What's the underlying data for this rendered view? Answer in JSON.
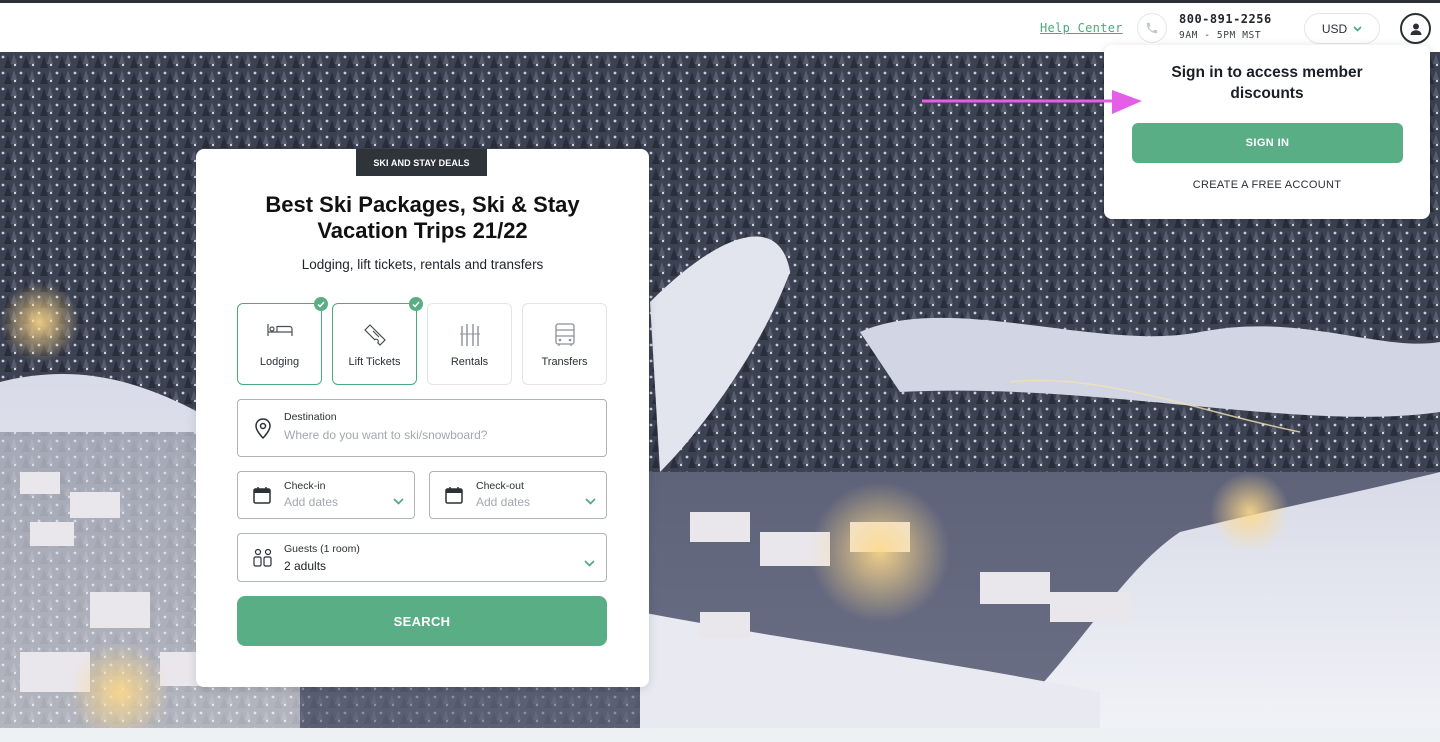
{
  "header": {
    "help_center": "Help Center",
    "phone_number": "800-891-2256",
    "phone_hours": "9AM - 5PM MST",
    "currency": "USD"
  },
  "hero_card": {
    "badge": "SKI AND STAY DEALS",
    "title_line1": "Best Ski Packages, Ski & Stay",
    "title_line2": "Vacation Trips 21/22",
    "subtitle": "Lodging, lift tickets, rentals and transfers",
    "products": [
      {
        "label": "Lodging",
        "icon": "bed-icon",
        "selected": true
      },
      {
        "label": "Lift Tickets",
        "icon": "ticket-icon",
        "selected": true
      },
      {
        "label": "Rentals",
        "icon": "skis-icon",
        "selected": false
      },
      {
        "label": "Transfers",
        "icon": "bus-icon",
        "selected": false
      }
    ],
    "destination": {
      "label": "Destination",
      "placeholder": "Where do you want to ski/snowboard?"
    },
    "checkin": {
      "label": "Check-in",
      "placeholder": "Add dates"
    },
    "checkout": {
      "label": "Check-out",
      "placeholder": "Add dates"
    },
    "guests": {
      "label": "Guests (1 room)",
      "value": "2 adults"
    },
    "search_label": "SEARCH"
  },
  "signin_popover": {
    "title": "Sign in to access member discounts",
    "signin_label": "SIGN IN",
    "create_label": "CREATE A FREE ACCOUNT"
  },
  "colors": {
    "accent": "#5aae86",
    "link": "#4aa97c",
    "dark": "#2f333a",
    "arrow": "#e45ee8"
  }
}
